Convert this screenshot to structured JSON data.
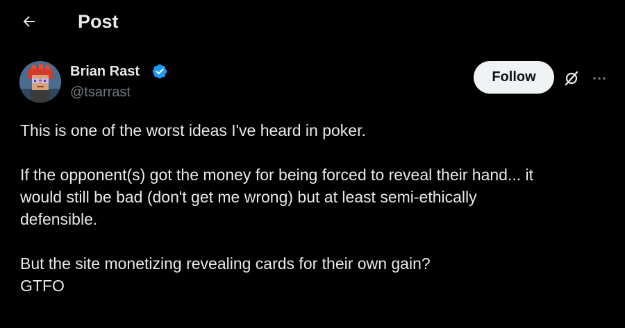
{
  "header": {
    "title": "Post",
    "back_icon": "arrow-left-icon"
  },
  "author": {
    "name": "Brian Rast",
    "handle": "@tsarrast",
    "verified": true,
    "verified_color": "#1d9bf0"
  },
  "actions": {
    "follow_label": "Follow",
    "grok_icon": "grok-icon",
    "more_icon": "more-horizontal-icon"
  },
  "post": {
    "paragraphs": [
      [
        "This is one of the worst ideas I've heard in poker."
      ],
      [
        "If the opponent(s) got the money for being forced to reveal their hand... it",
        "would still be bad (don't get me wrong) but at least semi-ethically",
        "defensible."
      ],
      [
        "But the site monetizing revealing cards for their own gain?",
        "GTFO"
      ]
    ]
  },
  "colors": {
    "background": "#000000",
    "text_primary": "#e7e9ea",
    "text_secondary": "#71767b",
    "follow_bg": "#eff3f4",
    "follow_text": "#0f1419"
  }
}
